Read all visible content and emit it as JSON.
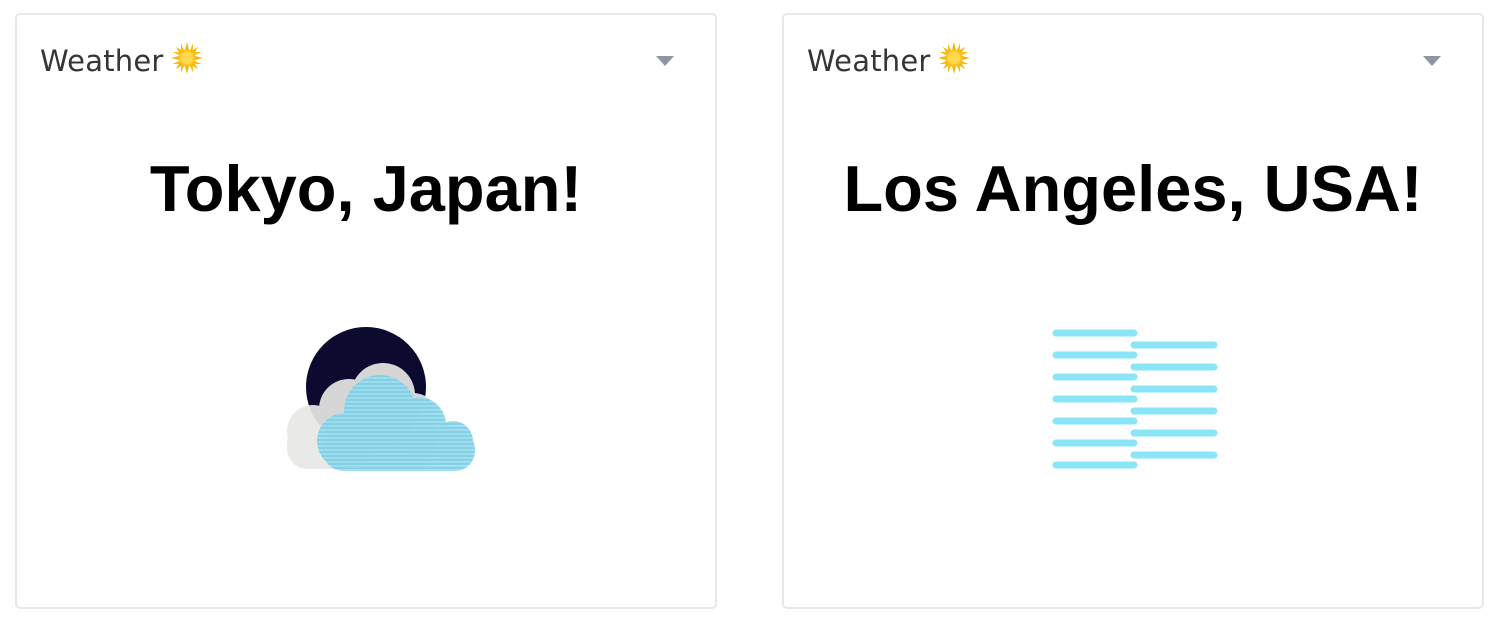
{
  "cards": [
    {
      "title": "Weather",
      "title_icon": "sun-icon",
      "city": "Tokyo, Japan!",
      "condition_icon": "cloudy-night-icon",
      "menu_icon": "caret-down-icon"
    },
    {
      "title": "Weather",
      "title_icon": "sun-icon",
      "city": "Los Angeles, USA!",
      "condition_icon": "fog-icon",
      "menu_icon": "caret-down-icon"
    }
  ],
  "colors": {
    "border": "#e6e7ea",
    "title_text": "#333538",
    "caret": "#8e95a3",
    "sun": "#f5b400",
    "moon": "#0c0a2e",
    "cloud_front": "#7fd0e6",
    "cloud_back": "#e8e8e6",
    "fog": "#8ae6f7"
  }
}
